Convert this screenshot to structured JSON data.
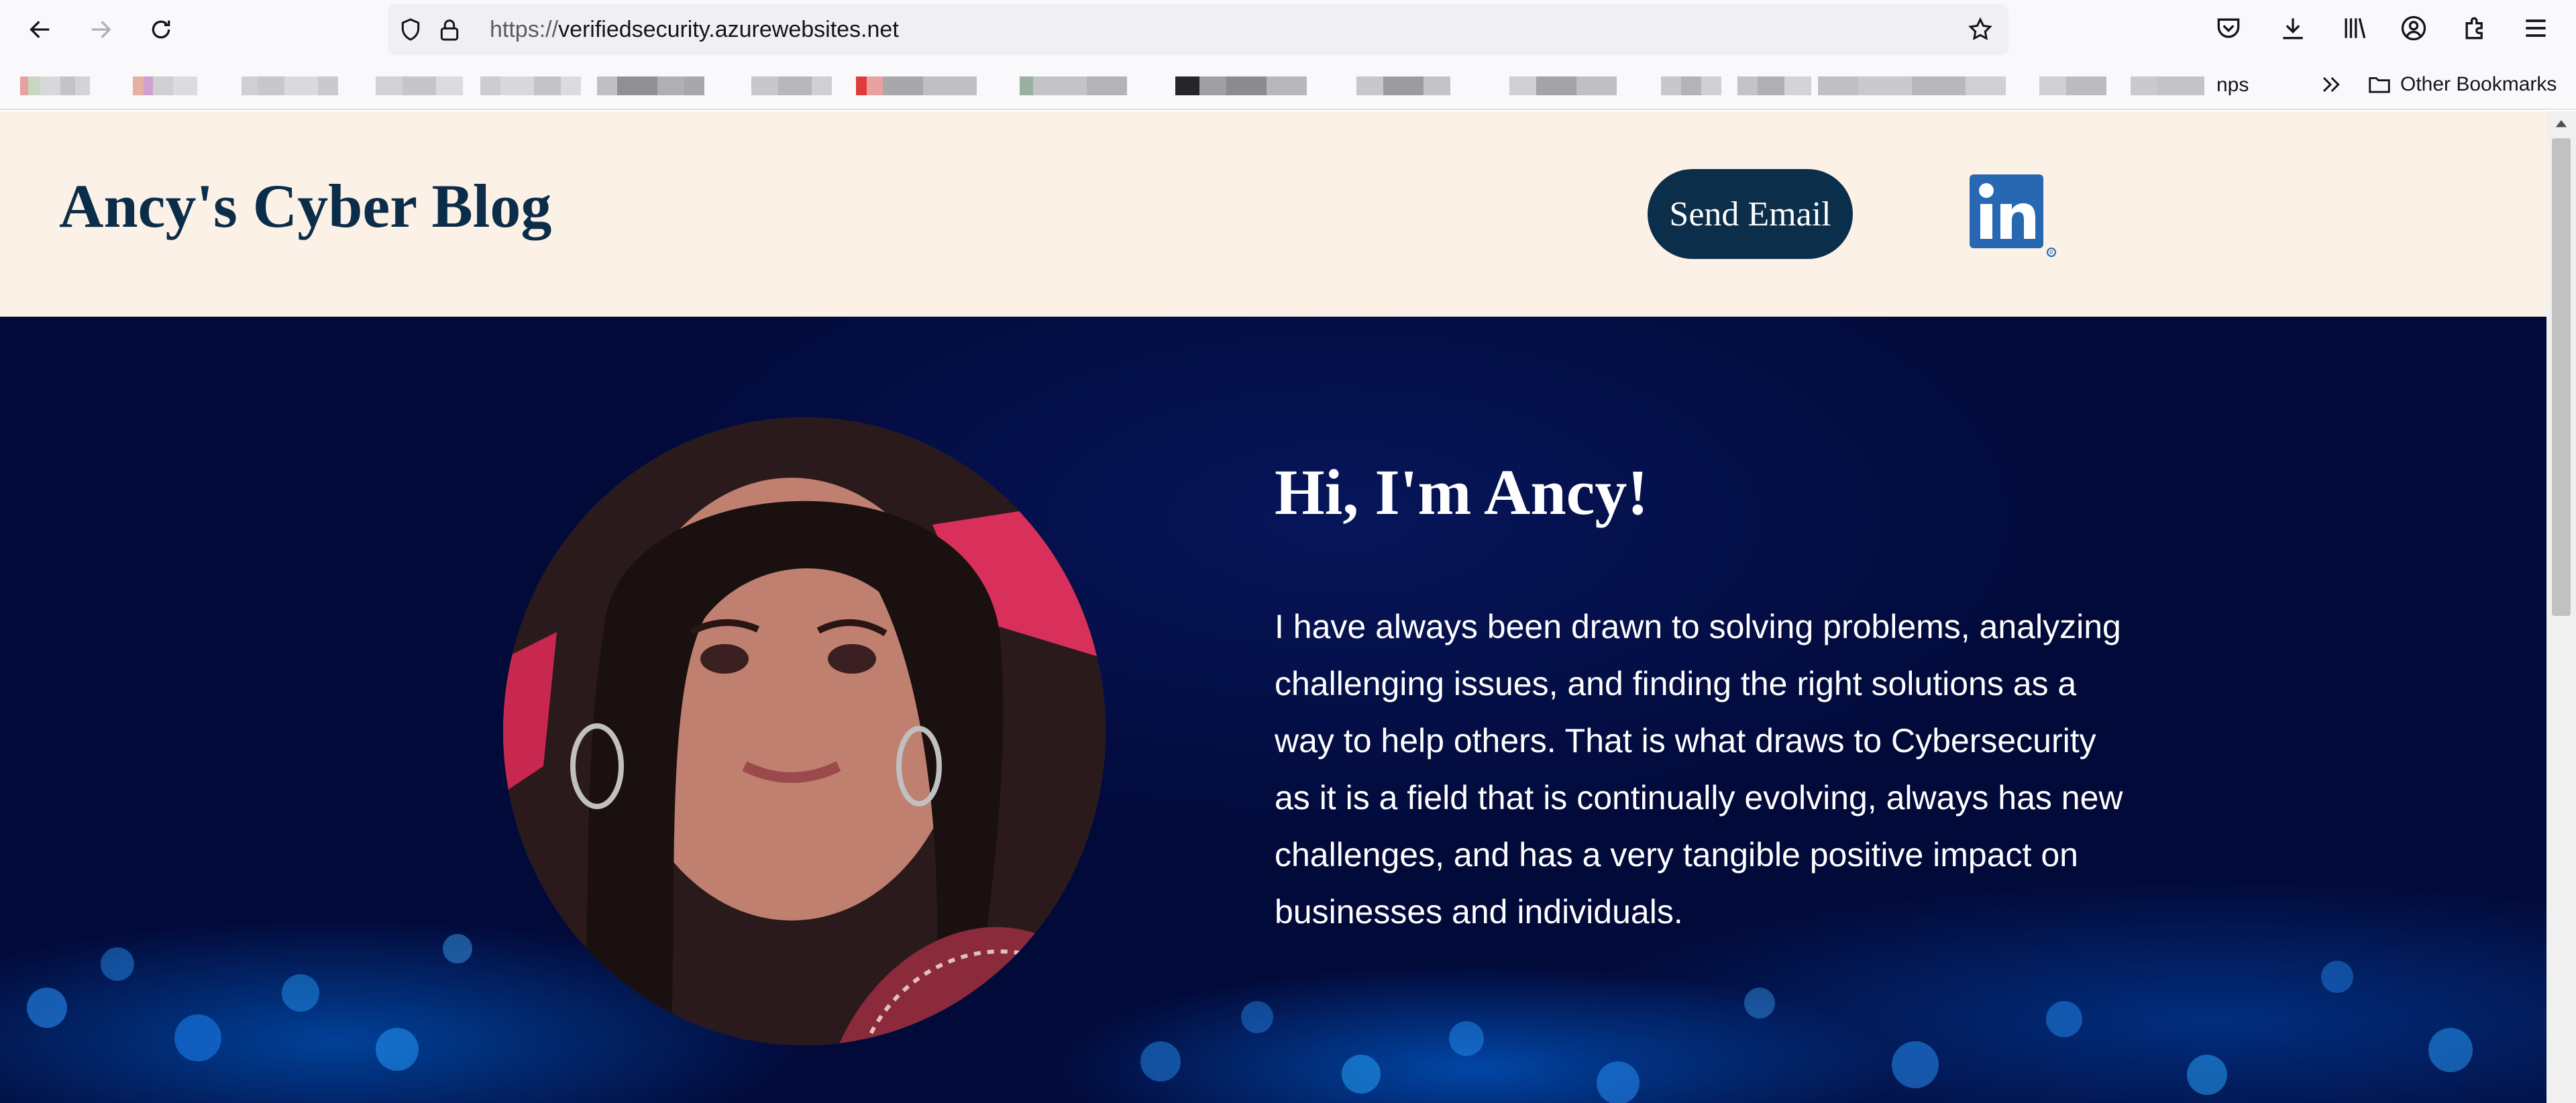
{
  "browser": {
    "url_scheme": "https://",
    "url_host": "verifiedsecurity.azurewebsites.net",
    "icons": {
      "back": "back-arrow-icon",
      "forward": "forward-arrow-icon",
      "reload": "reload-icon",
      "tracking": "shield-icon",
      "lock": "lock-icon",
      "bookmark": "star-icon",
      "pocket": "pocket-icon",
      "downloads": "download-icon",
      "library": "library-icon",
      "account": "account-icon",
      "extensions": "extensions-icon",
      "menu": "hamburger-menu-icon"
    }
  },
  "bookmarks": {
    "overflow_text": "nps",
    "other_label": "Other Bookmarks"
  },
  "site": {
    "title": "Ancy's Cyber Blog",
    "send_email_label": "Send Email",
    "linkedin_text": "in",
    "linkedin_color": "#2867b2"
  },
  "hero": {
    "heading": "Hi, I'm Ancy!",
    "body": "I have always been drawn to solving problems, analyzing challenging issues, and finding the right solutions as a way to help others. That is what draws to Cybersecurity as it is a field that is continually evolving, always has new challenges, and has a very tangible positive impact on businesses and individuals."
  },
  "colors": {
    "header_bg": "#fbf1e6",
    "title_color": "#0c2d4a",
    "button_bg": "#0b2e4a",
    "hero_bg": "#020a3a"
  }
}
